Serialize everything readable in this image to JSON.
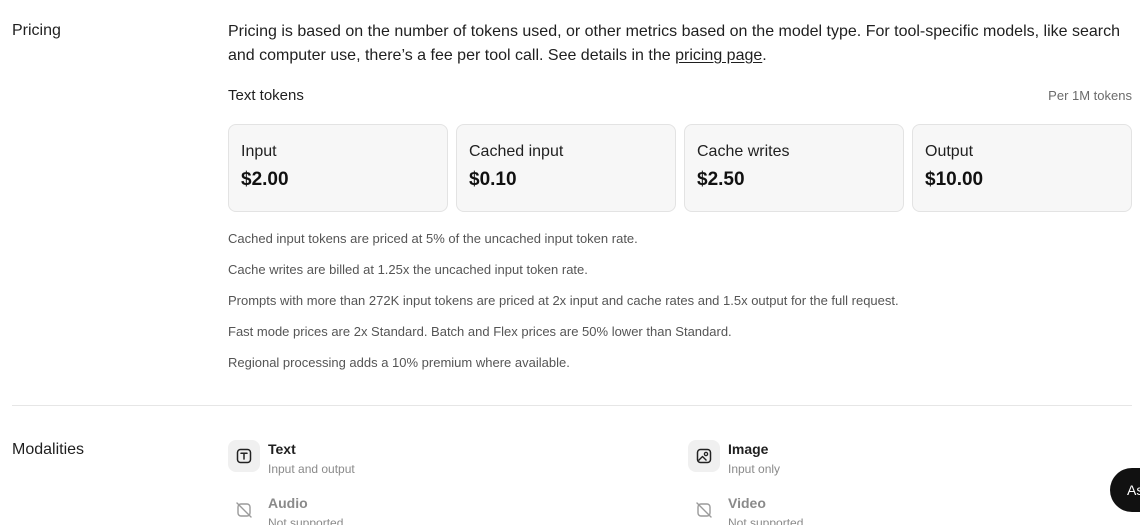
{
  "pricing": {
    "label": "Pricing",
    "intro_text": "Pricing is based on the number of tokens used, or other metrics based on the model type. For tool-specific models, like search and computer use, there’s a fee per tool call. See details in the ",
    "intro_link": "pricing page",
    "intro_end": ".",
    "text_tokens": {
      "title": "Text tokens",
      "unit": "Per 1M tokens",
      "cards": [
        {
          "label": "Input",
          "value": "$2.00"
        },
        {
          "label": "Cached input",
          "value": "$0.10"
        },
        {
          "label": "Cache writes",
          "value": "$2.50"
        },
        {
          "label": "Output",
          "value": "$10.00"
        }
      ]
    },
    "notes": [
      "Cached input tokens are priced at 5% of the uncached input token rate.",
      "Cache writes are billed at 1.25x the uncached input token rate.",
      "Prompts with more than 272K input tokens are priced at 2x input and cache rates and 1.5x output for the full request.",
      "Fast mode prices are 2x Standard. Batch and Flex prices are 50% lower than Standard.",
      "Regional processing adds a 10% premium where available."
    ]
  },
  "modalities": {
    "label": "Modalities",
    "items": [
      {
        "name": "Text",
        "status": "Input and output",
        "icon": "text-icon"
      },
      {
        "name": "Image",
        "status": "Input only",
        "icon": "image-icon"
      },
      {
        "name": "Audio",
        "status": "Not supported",
        "icon": "audio-unsupported-icon"
      },
      {
        "name": "Video",
        "status": "Not supported",
        "icon": "video-unsupported-icon"
      }
    ]
  },
  "ask_button": {
    "label": "As"
  }
}
